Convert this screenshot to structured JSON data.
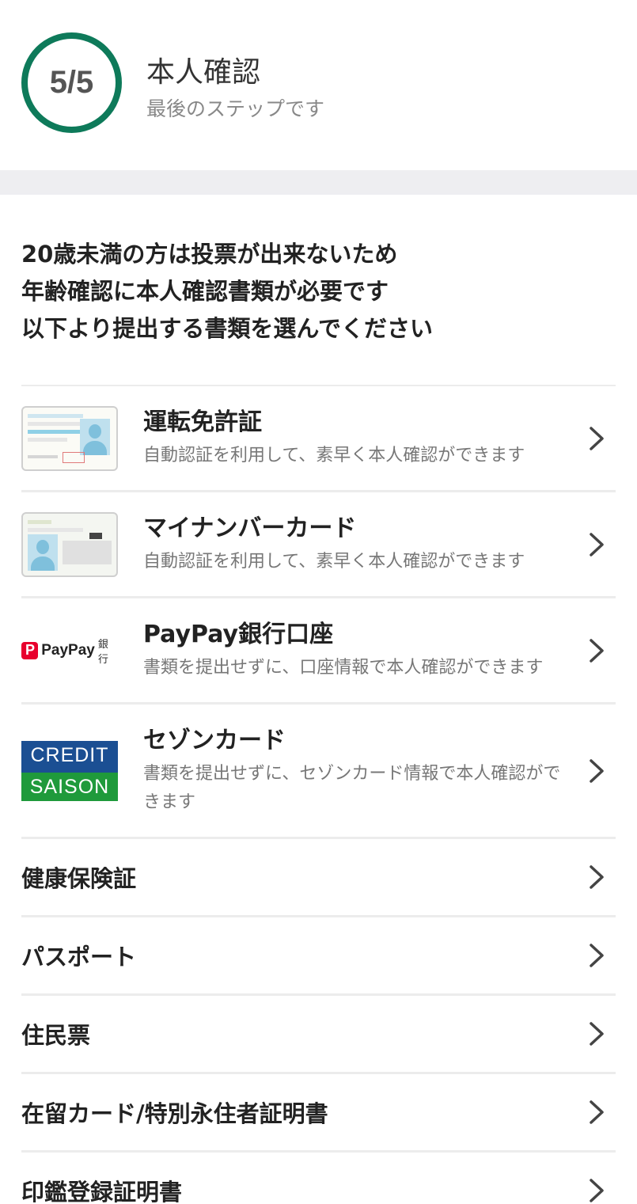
{
  "header": {
    "step": "5/5",
    "title": "本人確認",
    "subtitle": "最後のステップです"
  },
  "intro": {
    "lines": [
      "20歳未満の方は投票が出来ないため",
      "年齢確認に本人確認書類が必要です",
      "以下より提出する書類を選んでください"
    ]
  },
  "documents": [
    {
      "title": "運転免許証",
      "desc": "自動認証を利用して、素早く本人確認ができます",
      "icon": "drivers-license-card"
    },
    {
      "title": "マイナンバーカード",
      "desc": "自動認証を利用して、素早く本人確認ができます",
      "icon": "my-number-card"
    },
    {
      "title": "PayPay銀行口座",
      "desc": "書類を提出せずに、口座情報で本人確認ができます",
      "icon": "paypay-bank-logo"
    },
    {
      "title": "セゾンカード",
      "desc": "書類を提出せずに、セゾンカード情報で本人確認ができます",
      "icon": "credit-saison-logo"
    }
  ],
  "paypay_logo": {
    "text": "PayPay",
    "bank": "銀行"
  },
  "saison_logo": {
    "top": "CREDIT",
    "bottom": "SAISON"
  },
  "other_documents": [
    "健康保険証",
    "パスポート",
    "住民票",
    "在留カード/特別永住者証明書",
    "印鑑登録証明書"
  ],
  "colors": {
    "accent": "#0e7a5a",
    "paypay": "#e8002d",
    "saison_blue": "#1b4f93",
    "saison_green": "#1f9a3b"
  }
}
